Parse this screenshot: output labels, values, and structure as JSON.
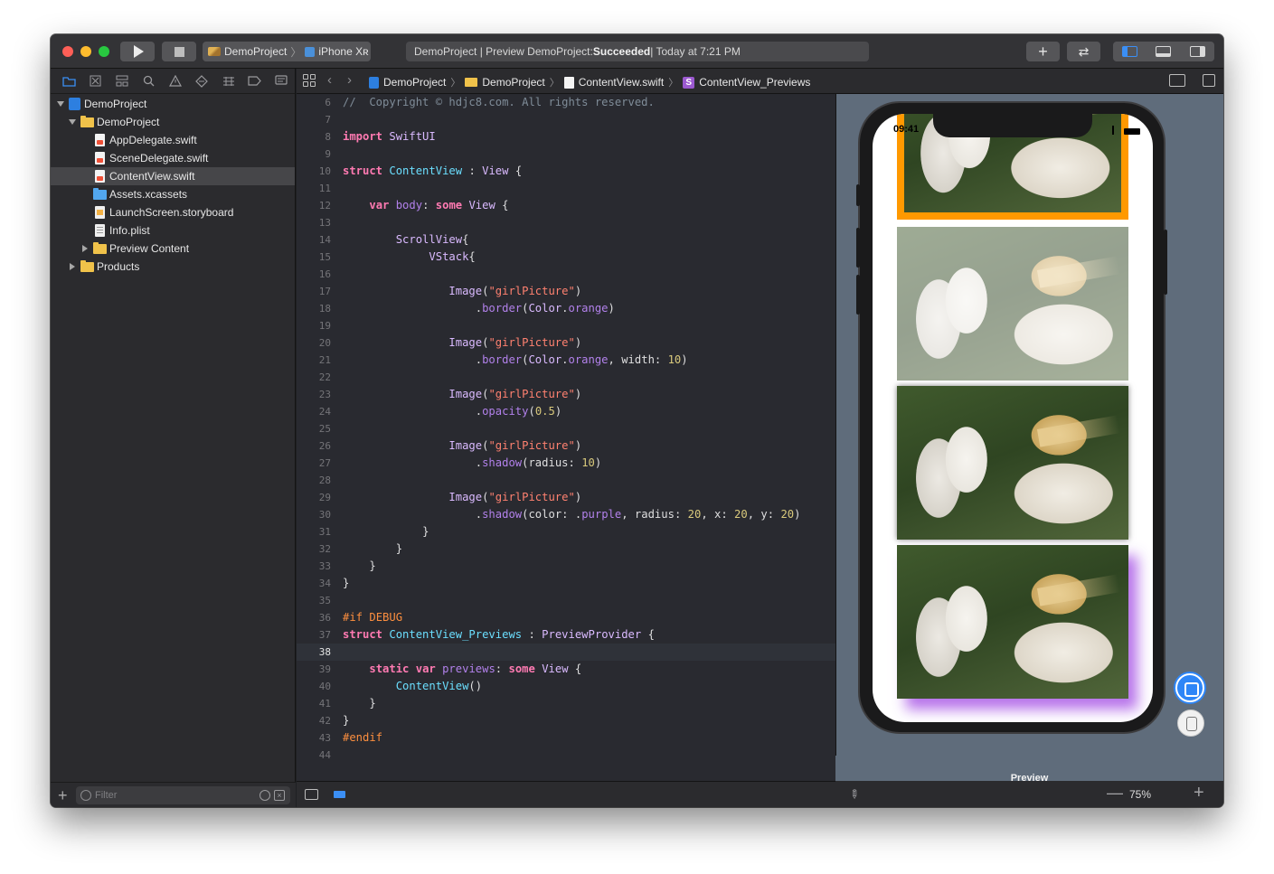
{
  "toolbar": {
    "scheme_project": "DemoProject",
    "scheme_device": "iPhone Xʀ",
    "activity_prefix": "DemoProject | Preview DemoProject: ",
    "activity_status": "Succeeded",
    "activity_time": " | Today at 7:21 PM",
    "library_icon": "plus-icon",
    "review_icon": "swap-arrows-icon"
  },
  "navigator": {
    "tabs": [
      "folder-icon",
      "x-square-icon",
      "hierarchy-icon",
      "search-icon",
      "warning-icon",
      "diamond-icon",
      "list-icon",
      "tag-icon",
      "comment-icon"
    ],
    "tree": [
      {
        "label": "DemoProject",
        "icon": "project-icon",
        "disclosure": "open"
      },
      {
        "label": "DemoProject",
        "icon": "folder-icon",
        "disclosure": "open"
      },
      {
        "label": "AppDelegate.swift",
        "icon": "swift-file-icon"
      },
      {
        "label": "SceneDelegate.swift",
        "icon": "swift-file-icon"
      },
      {
        "label": "ContentView.swift",
        "icon": "swift-file-icon",
        "selected": true
      },
      {
        "label": "Assets.xcassets",
        "icon": "asset-folder-icon"
      },
      {
        "label": "LaunchScreen.storyboard",
        "icon": "storyboard-icon"
      },
      {
        "label": "Info.plist",
        "icon": "plist-icon"
      },
      {
        "label": "Preview Content",
        "icon": "folder-icon",
        "disclosure": "closed"
      },
      {
        "label": "Products",
        "icon": "folder-icon",
        "disclosure": "closed"
      }
    ],
    "filter_placeholder": "Filter"
  },
  "jumpbar": {
    "crumbs": [
      "DemoProject",
      "DemoProject",
      "ContentView.swift",
      "ContentView_Previews"
    ],
    "struct_badge": "S"
  },
  "editor": {
    "current_line": 38,
    "lines": [
      {
        "n": "6",
        "t": "//  Copyright © hdjc8.com. All rights reserved."
      },
      {
        "n": "7",
        "t": ""
      },
      {
        "n": "8",
        "t": "import SwiftUI"
      },
      {
        "n": "9",
        "t": ""
      },
      {
        "n": "10",
        "t": "struct ContentView : View {"
      },
      {
        "n": "11",
        "t": ""
      },
      {
        "n": "12",
        "t": "    var body: some View {"
      },
      {
        "n": "13",
        "t": ""
      },
      {
        "n": "14",
        "t": "        ScrollView{"
      },
      {
        "n": "15",
        "t": "             VStack{"
      },
      {
        "n": "16",
        "t": ""
      },
      {
        "n": "17",
        "t": "                Image(\"girlPicture\")"
      },
      {
        "n": "18",
        "t": "                    .border(Color.orange)"
      },
      {
        "n": "19",
        "t": ""
      },
      {
        "n": "20",
        "t": "                Image(\"girlPicture\")"
      },
      {
        "n": "21",
        "t": "                    .border(Color.orange, width: 10)"
      },
      {
        "n": "22",
        "t": ""
      },
      {
        "n": "23",
        "t": "                Image(\"girlPicture\")"
      },
      {
        "n": "24",
        "t": "                    .opacity(0.5)"
      },
      {
        "n": "25",
        "t": ""
      },
      {
        "n": "26",
        "t": "                Image(\"girlPicture\")"
      },
      {
        "n": "27",
        "t": "                    .shadow(radius: 10)"
      },
      {
        "n": "28",
        "t": ""
      },
      {
        "n": "29",
        "t": "                Image(\"girlPicture\")"
      },
      {
        "n": "30",
        "t": "                    .shadow(color: .purple, radius: 20, x: 20, y: 20)"
      },
      {
        "n": "31",
        "t": "            }"
      },
      {
        "n": "32",
        "t": "        }"
      },
      {
        "n": "33",
        "t": "    }"
      },
      {
        "n": "34",
        "t": "}"
      },
      {
        "n": "35",
        "t": ""
      },
      {
        "n": "36",
        "t": "#if DEBUG"
      },
      {
        "n": "37",
        "t": "struct ContentView_Previews : PreviewProvider {"
      },
      {
        "n": "38",
        "t": ""
      },
      {
        "n": "39",
        "t": "    static var previews: some View {"
      },
      {
        "n": "40",
        "t": "        ContentView()"
      },
      {
        "n": "41",
        "t": "    }"
      },
      {
        "n": "42",
        "t": "}"
      },
      {
        "n": "43",
        "t": "#endif"
      },
      {
        "n": "44",
        "t": ""
      }
    ]
  },
  "preview": {
    "status_time": "09:41",
    "label": "Preview",
    "zoom": "75%",
    "zoom_minus": "—",
    "zoom_plus": "+",
    "colors": {
      "border": "#ff9900",
      "shadow": "#aa5ae6",
      "canvas": "#5f6c7b"
    }
  }
}
